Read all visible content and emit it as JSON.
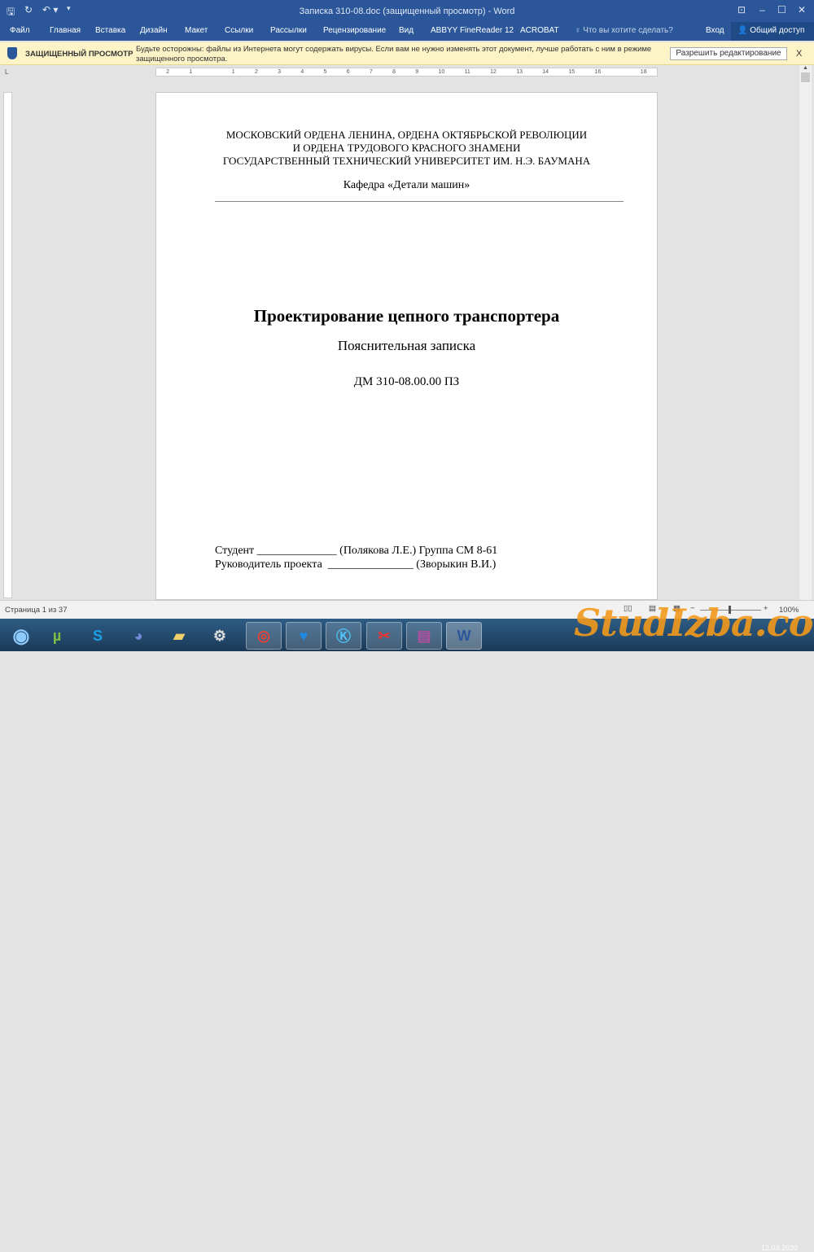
{
  "window": {
    "title": "Записка 310-08.doc (защищенный просмотр) - Word"
  },
  "ribbon": {
    "tabs": [
      "Файл",
      "Главная",
      "Вставка",
      "Дизайн",
      "Макет",
      "Ссылки",
      "Рассылки",
      "Рецензирование",
      "Вид",
      "ABBYY FineReader 12",
      "ACROBAT"
    ],
    "tell_me": "Что вы хотите сделать?",
    "sign_in": "Вход",
    "share": "Общий доступ"
  },
  "protected_view": {
    "label": "ЗАЩИЩЕННЫЙ ПРОСМОТР",
    "message": "Будьте осторожны: файлы из Интернета могут содержать вирусы. Если вам не нужно изменять этот документ, лучше работать с ним в режиме защищенного просмотра.",
    "enable_button": "Разрешить редактирование",
    "close": "X"
  },
  "ruler": {
    "ticks": [
      "2",
      "1",
      "",
      "1",
      "2",
      "3",
      "4",
      "5",
      "6",
      "7",
      "8",
      "9",
      "10",
      "11",
      "12",
      "13",
      "14",
      "15",
      "16",
      "",
      "18"
    ]
  },
  "document": {
    "header_lines": [
      "МОСКОВСКИЙ ОРДЕНА ЛЕНИНА, ОРДЕНА ОКТЯБРЬСКОЙ РЕВОЛЮЦИИ",
      "И ОРДЕНА ТРУДОВОГО КРАСНОГО ЗНАМЕНИ",
      "ГОСУДАРСТВЕННЫЙ ТЕХНИЧЕСКИЙ УНИВЕРСИТЕТ ИМ. Н.Э. БАУМАНА"
    ],
    "department": "Кафедра «Детали машин»",
    "title": "Проектирование цепного транспортера",
    "subtitle": "Пояснительная записка",
    "code": "ДМ 310-08.00.00 ПЗ",
    "student_line": "Студент ______________ (Полякова Л.Е.) Группа СМ 8-61",
    "supervisor_line": "Руководитель проекта  _______________ (Зворыкин В.И.)"
  },
  "status": {
    "page": "Страница 1 из 37",
    "zoom": "100%"
  },
  "taskbar": {
    "date": "12.03.2020"
  },
  "watermark": "StudIzba.com"
}
